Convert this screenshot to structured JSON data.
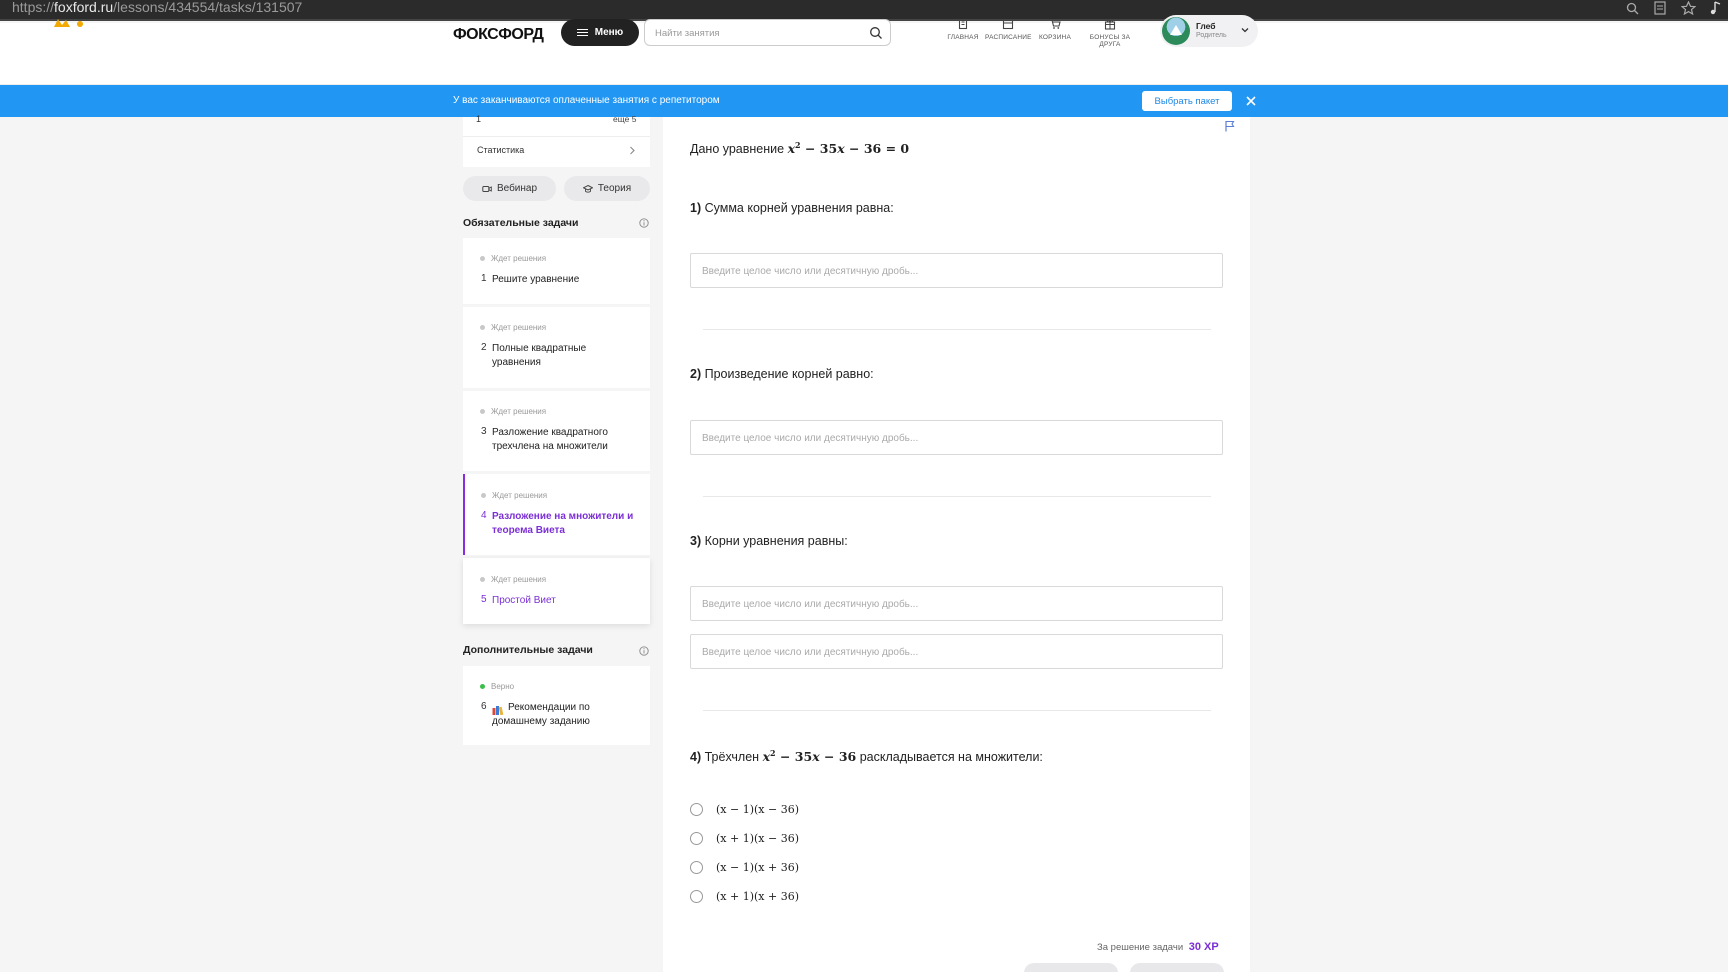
{
  "browser": {
    "url_prefix": "https://",
    "url_host": "foxford.ru",
    "url_path": "/lessons/434554/tasks/131507"
  },
  "header": {
    "logo": "ФОКСФОРД",
    "menu_label": "Меню",
    "search_placeholder": "Найти занятия",
    "nav": [
      {
        "label": "ГЛАВНАЯ",
        "icon": "home-icon"
      },
      {
        "label": "РАСПИСАНИЕ",
        "icon": "calendar-icon"
      },
      {
        "label": "КОРЗИНА",
        "icon": "cart-icon"
      },
      {
        "label": "БОНУСЫ ЗА ДРУГА",
        "icon": "gift-icon"
      }
    ],
    "user": {
      "name": "Глеб",
      "role": "Родитель"
    }
  },
  "banner": {
    "text": "У вас заканчиваются оплаченные занятия с репетитором",
    "button": "Выбрать пакет"
  },
  "sidebar": {
    "top_number": "1",
    "top_more": "еще 5",
    "stats_label": "Статистика",
    "webinar_label": "Вебинар",
    "theory_label": "Теория",
    "required_title": "Обязательные задачи",
    "extra_title": "Дополнительные задачи",
    "required_tasks": [
      {
        "status": "Ждет решения",
        "num": "1",
        "title": "Решите уравнение"
      },
      {
        "status": "Ждет решения",
        "num": "2",
        "title": "Полные квадратные уравнения"
      },
      {
        "status": "Ждет решения",
        "num": "3",
        "title": "Разложение квадратного трехчлена на множители"
      },
      {
        "status": "Ждет решения",
        "num": "4",
        "title": "Разложение на множители и теорема Виета"
      },
      {
        "status": "Ждет решения",
        "num": "5",
        "title": "Простой Виет"
      }
    ],
    "extra_tasks": [
      {
        "status": "Верно",
        "num": "6",
        "title": "Рекомендации по домашнему заданию"
      }
    ]
  },
  "task": {
    "intro": "Дано уравнение",
    "q1": {
      "num": "1)",
      "text": "Сумма корней уравнения равна:"
    },
    "q2": {
      "num": "2)",
      "text": "Произведение корней равно:"
    },
    "q3": {
      "num": "3)",
      "text": "Корни уравнения равны:"
    },
    "q4": {
      "num": "4)",
      "prefix": "Трёхчлен",
      "suffix": "раскладывается на множители:"
    },
    "input_placeholder": "Введите целое число или десятичную дробь...",
    "options": [
      "(x − 1)(x − 36)",
      "(x + 1)(x − 36)",
      "(x − 1)(x + 36)",
      "(x + 1)(x + 36)"
    ],
    "reward_label": "За решение задачи",
    "reward_value": "30 XP"
  },
  "colors": {
    "accent": "#7b2fd6",
    "banner": "#2196f3",
    "success": "#3cbf4a"
  }
}
